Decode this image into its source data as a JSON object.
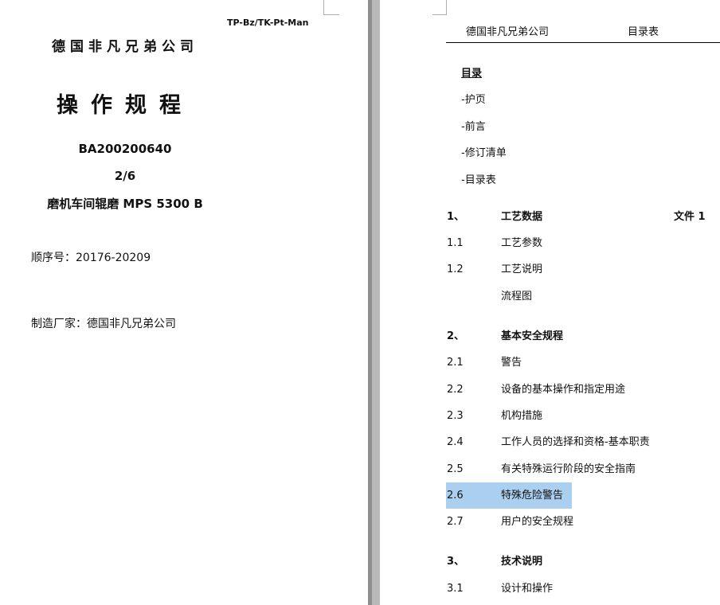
{
  "left_page": {
    "reference_code": "TP-Bz/TK-Pt-Man",
    "company": "德国非凡兄弟公司",
    "title": "操作规程",
    "document_number": "BA200200640",
    "part": "2/6",
    "machine": "磨机车间辊磨 MPS 5300 B",
    "serial_line": "顺序号：20176-20209",
    "manufacturer_line": "制造厂家：德国非凡兄弟公司"
  },
  "right_page": {
    "header": {
      "company": "德国非凡兄弟公司",
      "label": "目录表"
    },
    "toc_heading": "目录",
    "front_items": [
      "-护页",
      "-前言",
      "-修订清单",
      "-目录表"
    ],
    "sections": [
      {
        "num": "1、",
        "title": "工艺数据",
        "ref": "文件 1",
        "bold": true
      },
      {
        "num": "1.1",
        "title": "工艺参数",
        "ref": "",
        "bold": false
      },
      {
        "num": "1.2",
        "title": "工艺说明",
        "ref": "",
        "bold": false
      },
      {
        "num": "",
        "title": "流程图",
        "ref": "",
        "bold": false
      },
      {
        "num": "2、",
        "title": "基本安全规程",
        "ref": "",
        "bold": true
      },
      {
        "num": "2.1",
        "title": "警告",
        "ref": "",
        "bold": false
      },
      {
        "num": "2.2",
        "title": "设备的基本操作和指定用途",
        "ref": "",
        "bold": false
      },
      {
        "num": "2.3",
        "title": "机构措施",
        "ref": "",
        "bold": false
      },
      {
        "num": "2.4",
        "title": "工作人员的选择和资格-基本职责",
        "ref": "",
        "bold": false
      },
      {
        "num": "2.5",
        "title": "有关特殊运行阶段的安全指南",
        "ref": "",
        "bold": false
      },
      {
        "num": "2.6",
        "title": "特殊危险警告",
        "ref": "",
        "bold": false,
        "selected": true
      },
      {
        "num": "2.7",
        "title": "用户的安全规程",
        "ref": "",
        "bold": false
      },
      {
        "num": "3、",
        "title": "技术说明",
        "ref": "",
        "bold": true
      },
      {
        "num": "3.1",
        "title": "设计和操作",
        "ref": "",
        "bold": false
      }
    ]
  },
  "colors": {
    "selection_highlight": "#abcfef",
    "page_gutter": "#b9b9b9",
    "text": "#111111"
  }
}
